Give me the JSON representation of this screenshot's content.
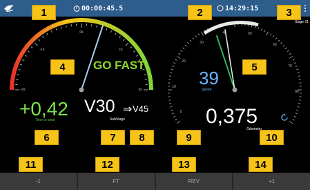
{
  "header": {
    "timer_left": "00:00:45.5",
    "timer_right": "14:29:15",
    "stage": "Stage 01"
  },
  "left_gauge": {
    "ticks": [
      "-2s",
      "-1s",
      "0s",
      "1s",
      "2s"
    ],
    "message": "GO FAST",
    "delta_value": "+0,42",
    "delta_label": "Time to ideal",
    "current": "V30",
    "arrow": "⇒",
    "next": "V45",
    "substage_label": "SubStage"
  },
  "right_gauge": {
    "ticks": [
      "0",
      "10",
      "20",
      "30",
      "40",
      "50",
      "60",
      "70",
      "80"
    ],
    "speed_value": "39",
    "speed_label": "Speed",
    "odometer_value": "0,375",
    "odometer_label": "Odometer"
  },
  "annotations": [
    "1",
    "2",
    "3",
    "4",
    "5",
    "6",
    "7",
    "8",
    "9",
    "10",
    "11",
    "12",
    "13",
    "14"
  ],
  "bottom_buttons": [
    "-1",
    "FT",
    "REV",
    "+1"
  ],
  "colors": {
    "topbar": "#2c5d8b",
    "badge": "#f6c419",
    "go_fast": "#8fd82e",
    "speed": "#6ab8ff"
  }
}
